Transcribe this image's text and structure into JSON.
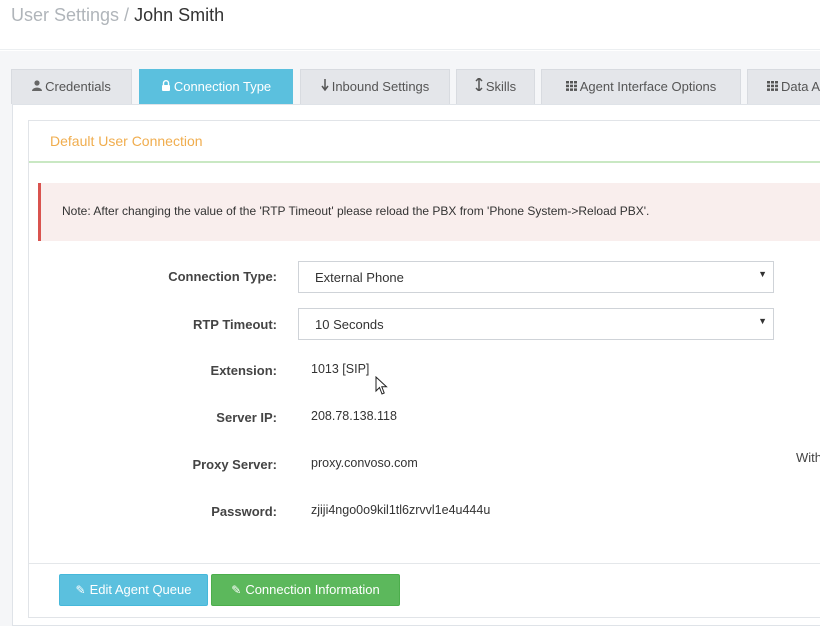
{
  "header": {
    "title_prefix": "User Settings /",
    "title_name": "John Smith"
  },
  "tabs": [
    {
      "label": "Credentials",
      "icon": "user-icon"
    },
    {
      "label": "Connection Type",
      "icon": "lock-icon"
    },
    {
      "label": "Inbound Settings",
      "icon": "arrow-down-icon"
    },
    {
      "label": "Skills",
      "icon": "arrows-vertical-icon"
    },
    {
      "label": "Agent Interface Options",
      "icon": "grid-icon"
    },
    {
      "label": "Data A",
      "icon": "grid-icon"
    }
  ],
  "panel": {
    "title": "Default User Connection",
    "note": "Note: After changing the value of the 'RTP Timeout' please reload the PBX from 'Phone System->Reload PBX'."
  },
  "form": {
    "connection_type": {
      "label": "Connection Type:",
      "value": "External Phone"
    },
    "rtp_timeout": {
      "label": "RTP Timeout:",
      "value": "10 Seconds"
    },
    "extension": {
      "label": "Extension:",
      "value": "1013 [SIP]"
    },
    "server_ip": {
      "label": "Server IP:",
      "value": "208.78.138.118"
    },
    "proxy_server": {
      "label": "Proxy Server:",
      "value": "proxy.convoso.com"
    },
    "password": {
      "label": "Password:",
      "value": "zjiji4ngo0o9kil1tl6zrvvl1e4u444u"
    },
    "side_text": "With"
  },
  "buttons": {
    "edit_agent_queue": "Edit Agent Queue",
    "connection_information": "Connection Information"
  },
  "colors": {
    "accent_info": "#5bc0de",
    "accent_success": "#5cb85c",
    "warning_text": "#f0ad4e",
    "danger": "#d9534f"
  }
}
